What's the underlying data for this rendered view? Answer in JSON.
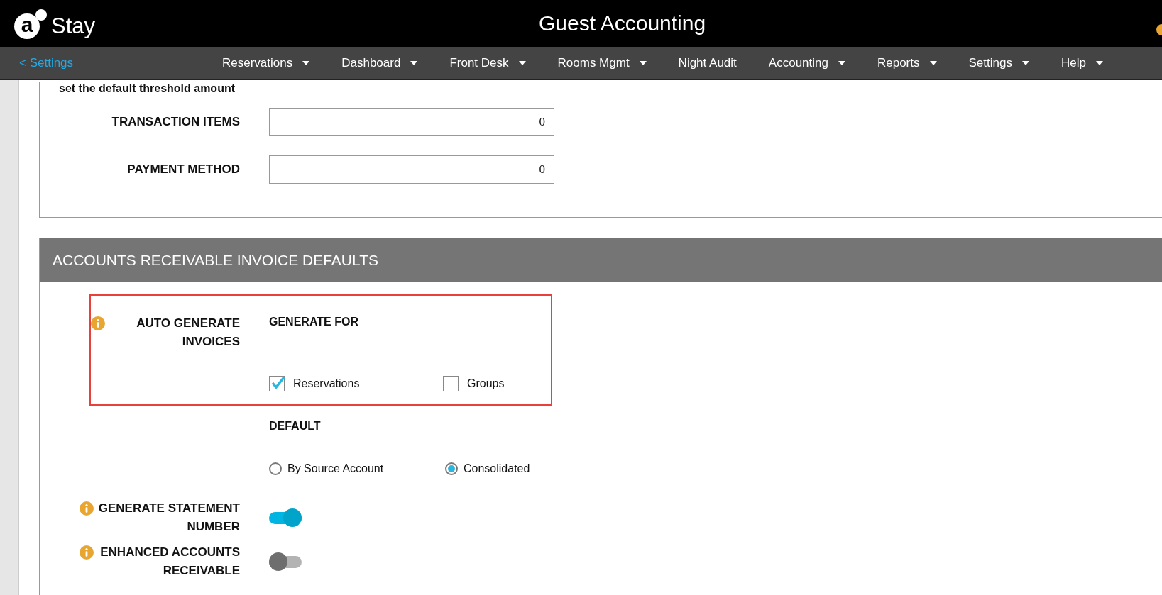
{
  "app": {
    "logo_letter": "a",
    "logo_text": "Stay",
    "title": "Guest Accounting"
  },
  "nav": {
    "back": "< Settings",
    "items": [
      {
        "label": "Reservations",
        "dropdown": true
      },
      {
        "label": "Dashboard",
        "dropdown": true
      },
      {
        "label": "Front Desk",
        "dropdown": true
      },
      {
        "label": "Rooms Mgmt",
        "dropdown": true
      },
      {
        "label": "Night Audit",
        "dropdown": false
      },
      {
        "label": "Accounting",
        "dropdown": true
      },
      {
        "label": "Reports",
        "dropdown": true
      },
      {
        "label": "Settings",
        "dropdown": true
      },
      {
        "label": "Help",
        "dropdown": true
      }
    ]
  },
  "threshold": {
    "note": "set the default threshold amount",
    "fields": [
      {
        "label": "TRANSACTION ITEMS",
        "value": "0"
      },
      {
        "label": "PAYMENT METHOD",
        "value": "0"
      }
    ]
  },
  "ar_section": {
    "title": "ACCOUNTS RECEIVABLE INVOICE DEFAULTS",
    "auto_generate": {
      "label": "AUTO GENERATE INVOICES",
      "highlighted": true,
      "generate_for_label": "GENERATE FOR",
      "options": [
        {
          "label": "Reservations",
          "checked": true
        },
        {
          "label": "Groups",
          "checked": false
        }
      ],
      "default_label": "DEFAULT",
      "default_options": [
        {
          "label": "By Source Account",
          "selected": false
        },
        {
          "label": "Consolidated",
          "selected": true
        }
      ]
    },
    "toggles": [
      {
        "label": "GENERATE STATEMENT NUMBER",
        "on": true
      },
      {
        "label": "ENHANCED ACCOUNTS RECEIVABLE",
        "on": false
      }
    ]
  }
}
